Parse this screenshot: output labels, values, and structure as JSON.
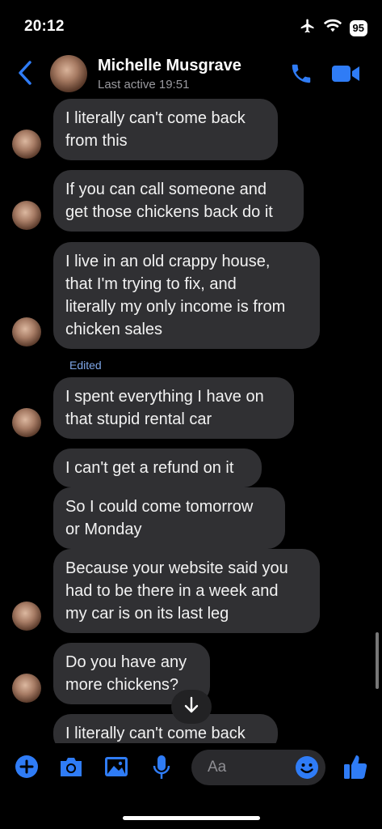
{
  "status": {
    "time": "20:12",
    "battery": "95",
    "icons": [
      "airplane-icon",
      "wifi-icon",
      "battery-icon"
    ]
  },
  "header": {
    "contact_name": "Michelle Musgrave",
    "last_active": "Last active 19:51",
    "icons": [
      "back-chevron-icon",
      "phone-icon",
      "video-camera-icon"
    ]
  },
  "messages": [
    {
      "lines": [
        "I literally can't come back",
        "from this"
      ]
    },
    {
      "lines": [
        "If you can call someone and",
        "get those chickens back do it"
      ]
    },
    {
      "lines": [
        "I live in an old crappy house,",
        "that I'm trying to fix, and",
        "literally my only income is from",
        "chicken sales"
      ]
    },
    {
      "edited_label": "Edited",
      "lines": [
        "I spent everything I have on",
        "that stupid rental car"
      ]
    },
    {
      "lines": [
        "I can't get a refund on it"
      ]
    },
    {
      "lines": [
        "So I could come tomorrow",
        "or Monday"
      ]
    },
    {
      "lines": [
        "Because your website said you",
        "had to be there in a week and",
        "my car is on its last leg"
      ]
    },
    {
      "lines": [
        "Do you have any",
        "more chickens?"
      ]
    },
    {
      "lines": [
        "I literally can't come back"
      ]
    }
  ],
  "composer": {
    "placeholder": "Aa",
    "icons": [
      "plus-icon",
      "camera-icon",
      "gallery-icon",
      "microphone-icon",
      "emoji-icon",
      "thumbs-up-icon"
    ]
  },
  "colors": {
    "accent": "#2f7cf6",
    "bubble": "#303033",
    "background": "#000000"
  }
}
